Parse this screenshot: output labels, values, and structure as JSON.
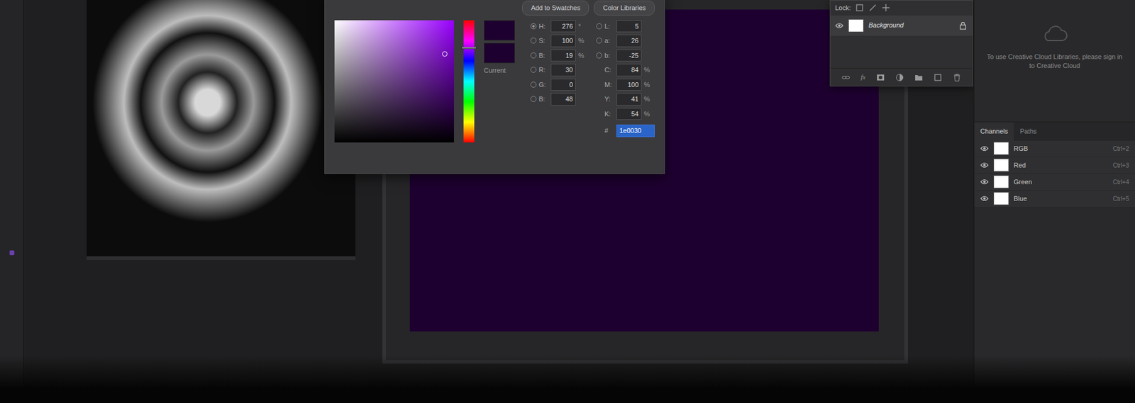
{
  "color_picker": {
    "add_to_swatches": "Add to Swatches",
    "color_libraries": "Color Libraries",
    "current_label": "Current",
    "hue_level": 0.22,
    "fields_left": [
      {
        "label": "H:",
        "value": "276",
        "unit": "°",
        "selected": true
      },
      {
        "label": "S:",
        "value": "100",
        "unit": "%",
        "selected": false
      },
      {
        "label": "B:",
        "value": "19",
        "unit": "%",
        "selected": false
      },
      {
        "label": "R:",
        "value": "30",
        "unit": "",
        "selected": false
      },
      {
        "label": "G:",
        "value": "0",
        "unit": "",
        "selected": false
      },
      {
        "label": "B:",
        "value": "48",
        "unit": "",
        "selected": false
      }
    ],
    "fields_right": [
      {
        "label": "L:",
        "value": "5",
        "unit": "",
        "selected": false
      },
      {
        "label": "a:",
        "value": "26",
        "unit": "",
        "selected": false
      },
      {
        "label": "b:",
        "value": "-25",
        "unit": "",
        "selected": false
      },
      {
        "label": "C:",
        "value": "84",
        "unit": "%"
      },
      {
        "label": "M:",
        "value": "100",
        "unit": "%"
      },
      {
        "label": "Y:",
        "value": "41",
        "unit": "%"
      },
      {
        "label": "K:",
        "value": "54",
        "unit": "%"
      }
    ],
    "hex_label": "#",
    "hex_value": "1e0030"
  },
  "layers": {
    "lock_label": "Lock:",
    "items": [
      {
        "name": "Background",
        "visible": true,
        "locked": true
      }
    ],
    "fx": "fx"
  },
  "libraries": {
    "message": "To use Creative Cloud Libraries, please sign in to Creative Cloud"
  },
  "channels": {
    "tabs": [
      {
        "label": "Channels",
        "selected": true
      },
      {
        "label": "Paths",
        "selected": false
      }
    ],
    "items": [
      {
        "name": "RGB",
        "shortcut": "Ctrl+2",
        "visible": true
      },
      {
        "name": "Red",
        "shortcut": "Ctrl+3",
        "visible": true
      },
      {
        "name": "Green",
        "shortcut": "Ctrl+4",
        "visible": true
      },
      {
        "name": "Blue",
        "shortcut": "Ctrl+5",
        "visible": true
      }
    ]
  }
}
